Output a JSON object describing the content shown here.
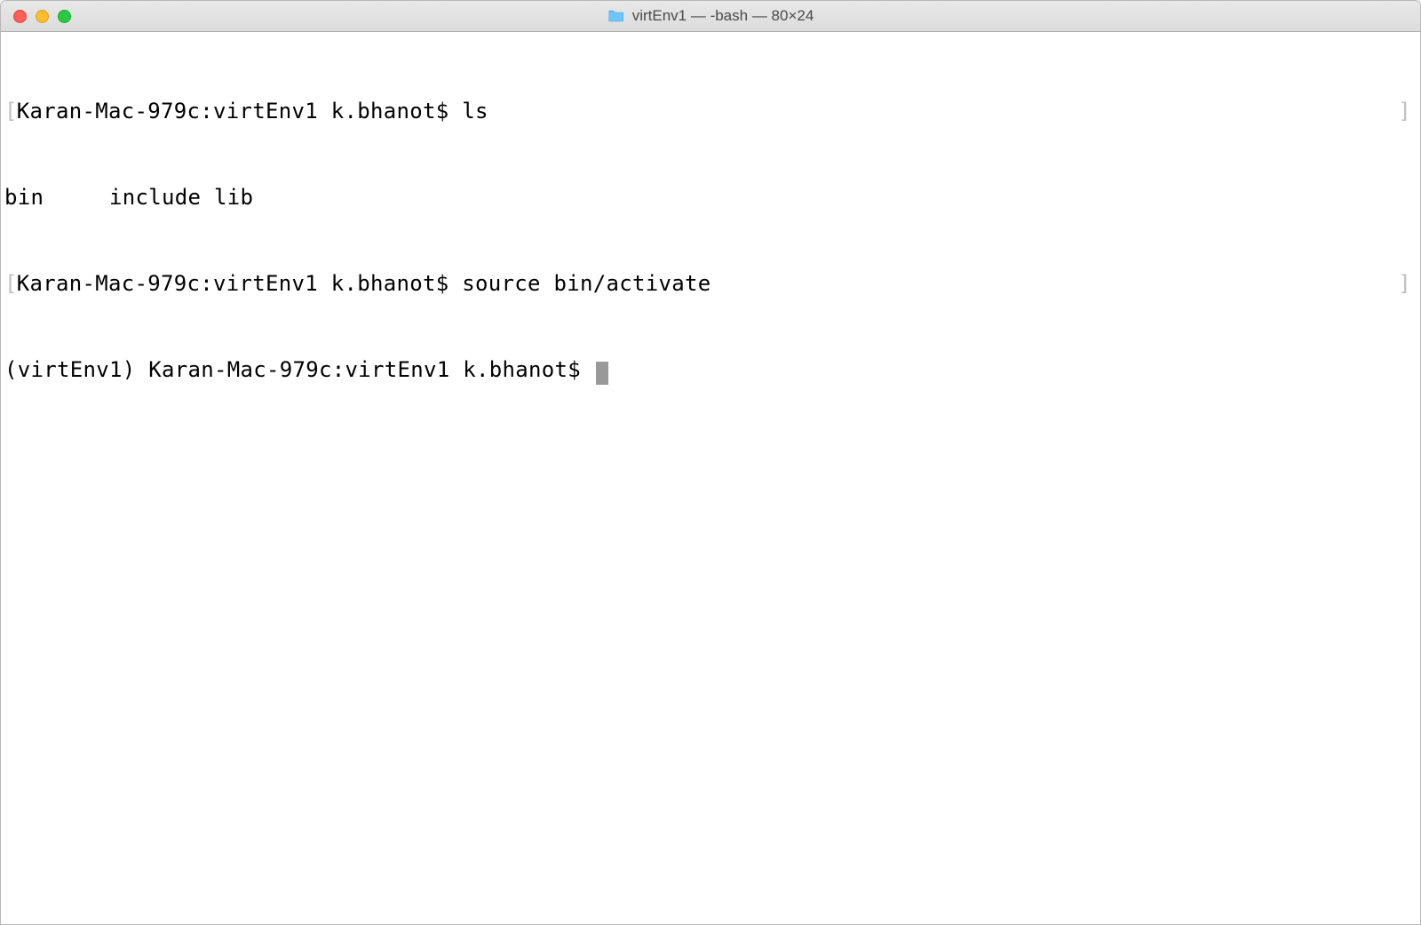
{
  "window": {
    "title": "virtEnv1 — -bash — 80×24"
  },
  "terminal": {
    "lines": [
      {
        "has_bracket": true,
        "prompt": "Karan-Mac-979c:virtEnv1 k.bhanot$ ",
        "command": "ls"
      },
      {
        "has_bracket": false,
        "output": "bin     include lib"
      },
      {
        "has_bracket": true,
        "prompt": "Karan-Mac-979c:virtEnv1 k.bhanot$ ",
        "command": "source bin/activate"
      },
      {
        "has_bracket": false,
        "prompt": "(virtEnv1) Karan-Mac-979c:virtEnv1 k.bhanot$ ",
        "command": "",
        "cursor": true
      }
    ]
  }
}
